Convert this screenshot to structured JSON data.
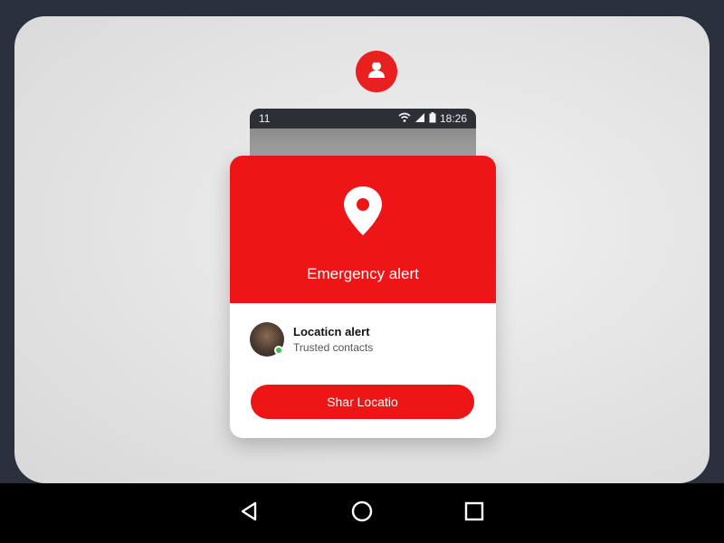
{
  "header": {
    "avatar_icon": "person-icon"
  },
  "status_bar": {
    "left_text": "11",
    "time": "18:26",
    "icons": [
      "wifi-icon",
      "signal-icon",
      "battery-icon"
    ]
  },
  "alert_card": {
    "icon": "location-pin-icon",
    "title": "Emergency alert",
    "contact": {
      "title": "Locaticn alert",
      "subtitle": "Trusted contacts",
      "status": "online"
    },
    "share_button_label": "Shar Locatio"
  },
  "navigation_bar": {
    "buttons": [
      "back-icon",
      "home-icon",
      "recents-icon"
    ]
  },
  "colors": {
    "accent": "#ee1516",
    "background": "#e4e4e4",
    "online": "#3fc24b"
  }
}
